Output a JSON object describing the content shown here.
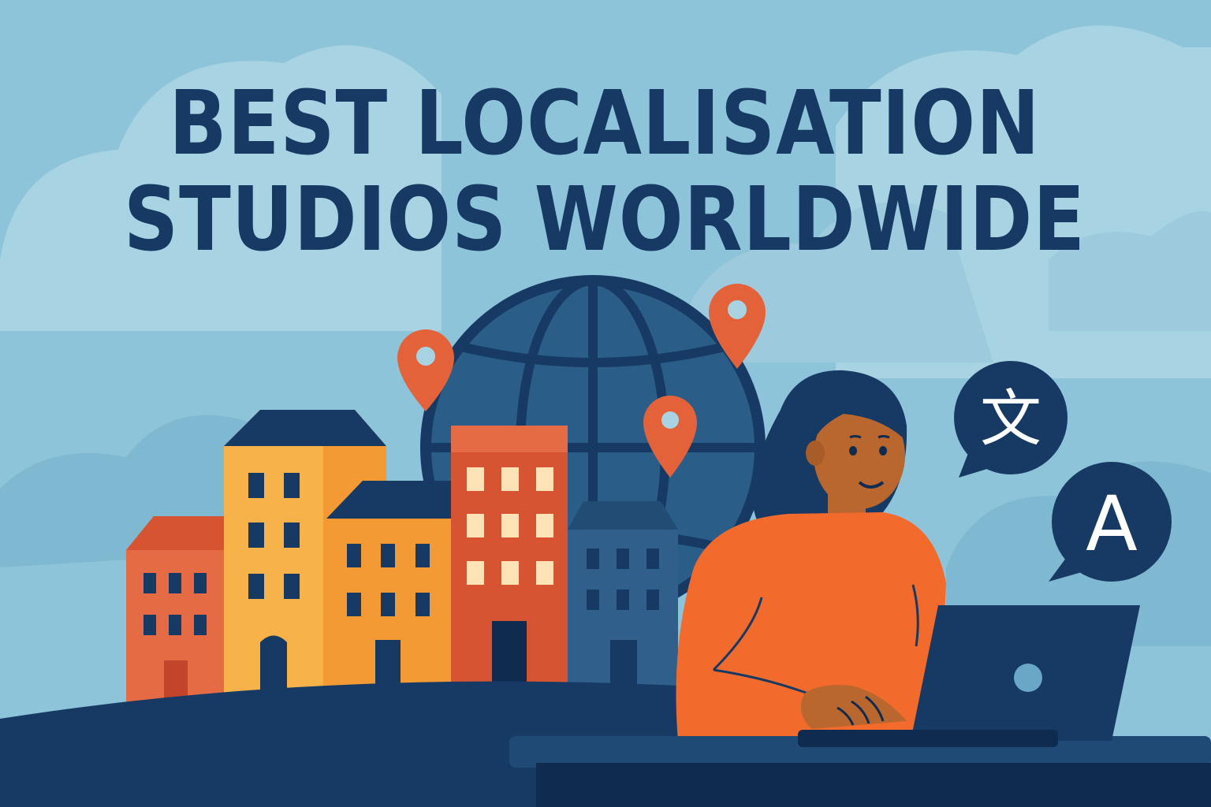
{
  "headline": {
    "line1": "BEST LOCALISATION",
    "line2": "STUDIOS WORLDWIDE"
  },
  "speech_bubbles": [
    {
      "glyph": "文",
      "icon": "chinese-character-bubble-icon"
    },
    {
      "glyph": "A",
      "icon": "latin-letter-bubble-icon"
    }
  ],
  "icons": [
    "globe-icon",
    "location-pin-icon",
    "buildings",
    "person-with-laptop",
    "laptop-icon"
  ],
  "colors": {
    "sky": "#8ec4d9",
    "cloud_light": "#a8d3e2",
    "navy": "#163a64",
    "dark_navy": "#0f2b4f",
    "orange": "#f26b2d",
    "pin_orange": "#e4623a",
    "yellow": "#f8b24a",
    "amber": "#f39a35",
    "brick": "#d65432",
    "blue_building": "#2f5f8a"
  }
}
